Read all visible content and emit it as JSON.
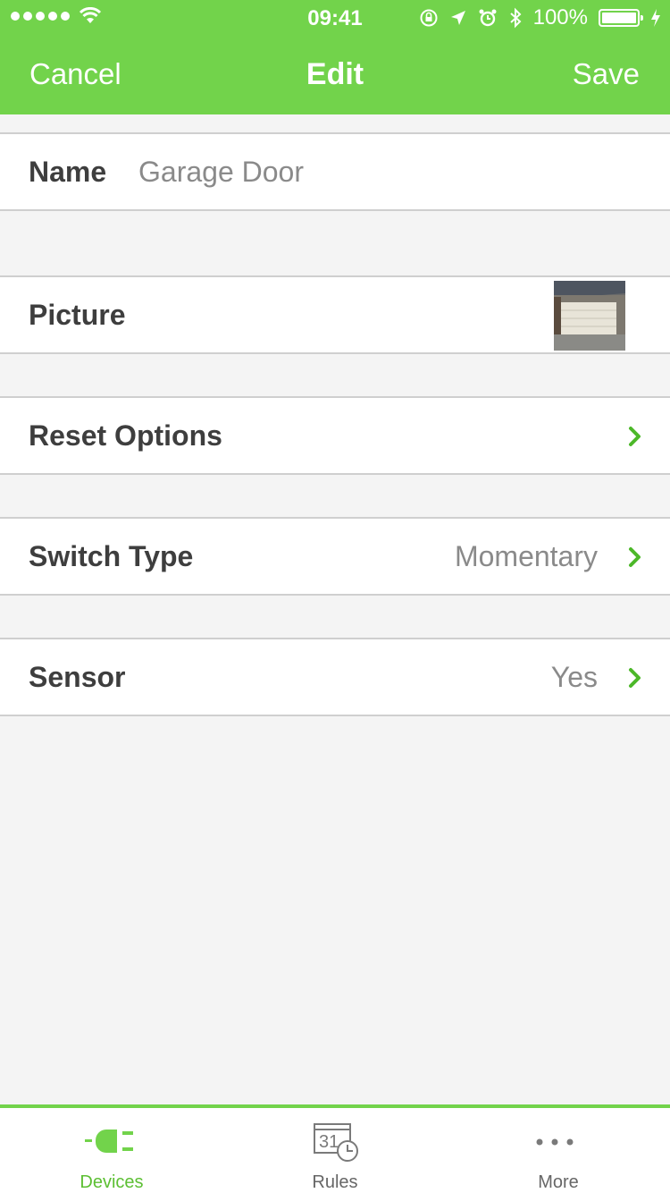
{
  "status_bar": {
    "time": "09:41",
    "battery": "100%",
    "signal_dots": 5
  },
  "nav": {
    "cancel_label": "Cancel",
    "title": "Edit",
    "save_label": "Save"
  },
  "form": {
    "name": {
      "label": "Name",
      "value": "Garage Door"
    },
    "picture": {
      "label": "Picture"
    },
    "reset_options": {
      "label": "Reset Options"
    },
    "switch_type": {
      "label": "Switch Type",
      "value": "Momentary"
    },
    "sensor": {
      "label": "Sensor",
      "value": "Yes"
    }
  },
  "tabs": [
    {
      "label": "Devices",
      "icon": "plug-icon",
      "active": true
    },
    {
      "label": "Rules",
      "icon": "calendar-clock-icon",
      "active": false
    },
    {
      "label": "More",
      "icon": "more-dots-icon",
      "active": false
    }
  ],
  "colors": {
    "brand_green": "#72d34b",
    "active_tab": "#5cbf33",
    "background": "#f4f4f4"
  }
}
